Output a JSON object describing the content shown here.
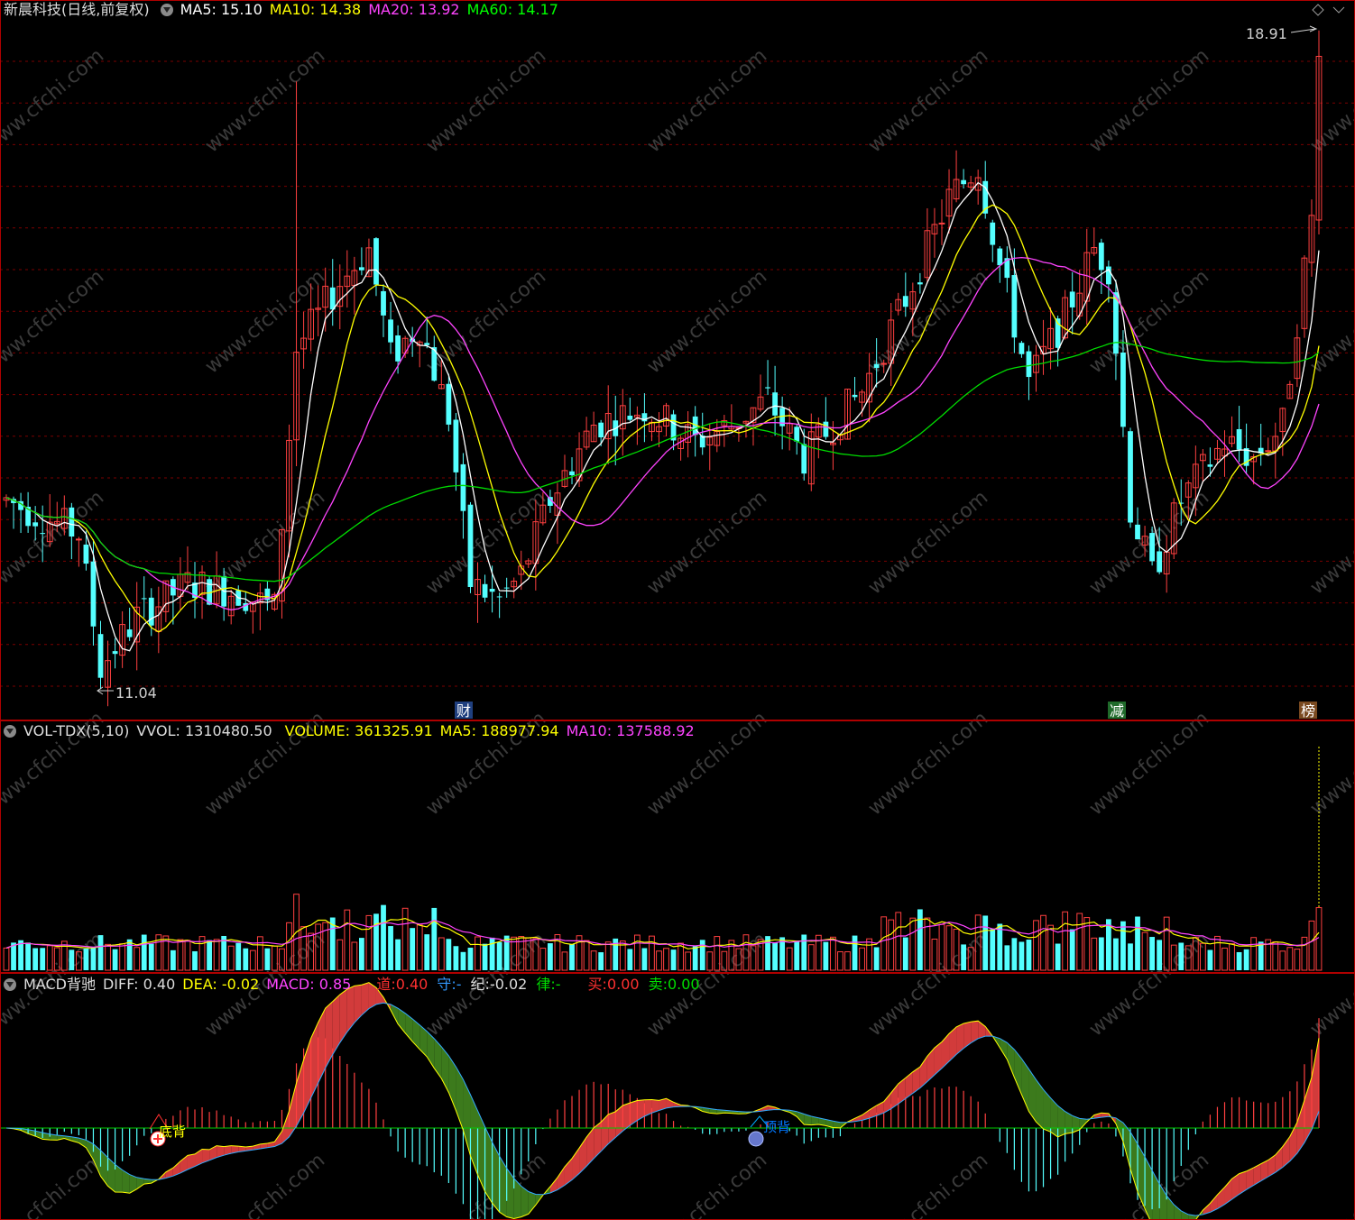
{
  "main_header": {
    "title": "新晨科技(日线,前复权)",
    "ma5": "MA5: 15.10",
    "ma10": "MA10: 14.38",
    "ma20": "MA20: 13.92",
    "ma60": "MA60: 14.17"
  },
  "vol_header": {
    "name": "VOL-TDX(5,10)",
    "vvol": "VVOL: 1310480.50",
    "volume": "VOLUME: 361325.91",
    "ma5": "MA5: 188977.94",
    "ma10": "MA10: 137588.92"
  },
  "macd_header": {
    "name": "MACD背驰",
    "diff": "DIFF: 0.40",
    "dea": "DEA: -0.02",
    "macd": "MACD: 0.85",
    "dao_label": "道:",
    "dao_value": "0.40",
    "shou_label": "守:",
    "shou_value": "-",
    "ji_label": "纪:",
    "ji_value": "-0.02",
    "lv_label": "律:",
    "lv_value": "-",
    "buy_label": "买:",
    "buy_value": "0.00",
    "sell_label": "卖:",
    "sell_value": "0.00"
  },
  "annotations": {
    "high": "18.91",
    "low": "11.04",
    "event_cai": "财",
    "event_jian": "减",
    "event_bang": "榜",
    "bottom_div": "底背",
    "top_div": "顶背"
  },
  "watermark": "www.cfchi.com",
  "colors": {
    "up": "#ff4040",
    "down": "#54ffff",
    "ma5": "#ffffff",
    "ma10": "#ffff00",
    "ma20": "#ff44ff",
    "ma60": "#00dd00",
    "grid": "#7a0000",
    "pane_border": "#b00000"
  }
}
